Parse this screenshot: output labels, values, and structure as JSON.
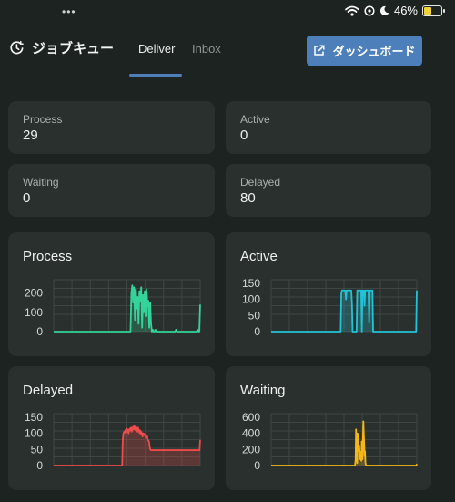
{
  "statusbar": {
    "more": "•••",
    "battery_text": "46%",
    "battery_level": 0.46,
    "icons": [
      "wifi-icon",
      "focus-icon",
      "moon-icon",
      "battery-icon"
    ]
  },
  "header": {
    "title": "ジョブキュー",
    "tabs": [
      {
        "label": "Deliver",
        "active": true
      },
      {
        "label": "Inbox",
        "active": false
      }
    ],
    "dashboard_button": "ダッシュボード"
  },
  "stats": [
    {
      "label": "Process",
      "value": "29"
    },
    {
      "label": "Active",
      "value": "0"
    },
    {
      "label": "Waiting",
      "value": "0"
    },
    {
      "label": "Delayed",
      "value": "80"
    }
  ],
  "colors": {
    "accent": "#4d7fba",
    "process": "#34d399",
    "active": "#22c3d6",
    "delayed": "#ef4b4b",
    "waiting": "#f5b816"
  },
  "chart_data": [
    {
      "type": "area",
      "title": "Process",
      "color": "#34d399",
      "ylim": [
        0,
        250
      ],
      "yticks": [
        0,
        100,
        200
      ],
      "grid": true,
      "values": [
        0,
        0,
        0,
        0,
        0,
        0,
        0,
        0,
        0,
        0,
        0,
        0,
        0,
        0,
        0,
        0,
        0,
        0,
        0,
        0,
        0,
        0,
        0,
        0,
        0,
        0,
        0,
        0,
        0,
        0,
        0,
        0,
        0,
        0,
        0,
        0,
        0,
        0,
        0,
        0,
        0,
        0,
        0,
        0,
        0,
        0,
        0,
        0,
        0,
        0,
        0,
        0,
        0,
        0,
        0,
        0,
        0,
        0,
        0,
        0,
        0,
        0,
        0,
        0,
        0,
        0,
        0,
        0,
        0,
        0,
        0,
        0,
        0,
        0,
        0,
        0,
        0,
        0,
        0,
        0,
        0,
        0,
        0,
        0,
        0,
        0,
        0,
        200,
        240,
        150,
        230,
        60,
        220,
        120,
        180,
        40,
        210,
        160,
        230,
        20,
        190,
        100,
        210,
        80,
        220,
        130,
        160,
        20,
        150,
        40,
        0,
        10,
        0,
        0,
        10,
        0,
        0,
        0,
        0,
        0,
        0,
        0,
        0,
        0,
        0,
        0,
        0,
        0,
        0,
        0,
        0,
        0,
        0,
        0,
        0,
        0,
        0,
        10,
        0,
        0,
        0,
        0,
        0,
        0,
        0,
        0,
        0,
        0,
        0,
        0,
        0,
        0,
        0,
        0,
        0,
        0,
        0,
        0,
        0,
        0,
        0,
        10,
        0,
        0,
        140
      ]
    },
    {
      "type": "area",
      "title": "Active",
      "color": "#22c3d6",
      "ylim": [
        0,
        150
      ],
      "yticks": [
        0,
        50,
        100,
        150
      ],
      "grid": true,
      "values": [
        0,
        0,
        0,
        0,
        0,
        0,
        0,
        0,
        0,
        0,
        0,
        0,
        0,
        0,
        0,
        0,
        0,
        0,
        0,
        0,
        0,
        0,
        0,
        0,
        0,
        0,
        0,
        0,
        0,
        0,
        0,
        0,
        0,
        0,
        0,
        0,
        0,
        0,
        0,
        0,
        0,
        0,
        0,
        0,
        0,
        0,
        0,
        0,
        0,
        0,
        0,
        0,
        0,
        0,
        0,
        0,
        0,
        0,
        0,
        0,
        0,
        0,
        0,
        0,
        0,
        0,
        0,
        0,
        0,
        0,
        0,
        0,
        0,
        0,
        0,
        0,
        0,
        0,
        0,
        0,
        0,
        0,
        0,
        0,
        0,
        0,
        0,
        0,
        0,
        0,
        0,
        0,
        0,
        0,
        0,
        0,
        0,
        0,
        0,
        0,
        0,
        0,
        0,
        0,
        0,
        0,
        120,
        128,
        128,
        128,
        128,
        128,
        128,
        100,
        128,
        128,
        128,
        128,
        128,
        128,
        128,
        128,
        90,
        0,
        0,
        0,
        0,
        0,
        0,
        0,
        128,
        128,
        128,
        128,
        128,
        128,
        128,
        0,
        128,
        128,
        128,
        80,
        128,
        128,
        128,
        128,
        128,
        128,
        30,
        128,
        128,
        128,
        128,
        128,
        0,
        0,
        0,
        0,
        0,
        0,
        0,
        0,
        0,
        0,
        0,
        0,
        0,
        0,
        0,
        0,
        0,
        0,
        0,
        0,
        0,
        0,
        0,
        0,
        0,
        0,
        0,
        0,
        0,
        0,
        0,
        0,
        0,
        0,
        0,
        0,
        0,
        0,
        0,
        0,
        0,
        0,
        0,
        0,
        0,
        0,
        0,
        0,
        0,
        0,
        0,
        0,
        0,
        0,
        0,
        0,
        0,
        0,
        0,
        0,
        0,
        0,
        0,
        0,
        0,
        0,
        128
      ]
    },
    {
      "type": "area",
      "title": "Delayed",
      "color": "#ef4b4b",
      "ylim": [
        0,
        150
      ],
      "yticks": [
        0,
        50,
        100,
        150
      ],
      "grid": true,
      "values": [
        0,
        0,
        0,
        0,
        0,
        0,
        0,
        0,
        0,
        0,
        0,
        0,
        0,
        0,
        0,
        0,
        0,
        0,
        0,
        0,
        0,
        0,
        0,
        0,
        0,
        0,
        0,
        0,
        0,
        0,
        0,
        0,
        0,
        0,
        0,
        0,
        0,
        0,
        0,
        0,
        0,
        0,
        0,
        0,
        0,
        0,
        0,
        0,
        0,
        0,
        0,
        0,
        0,
        0,
        0,
        0,
        0,
        0,
        0,
        0,
        0,
        0,
        0,
        0,
        0,
        0,
        0,
        0,
        0,
        0,
        0,
        0,
        0,
        0,
        0,
        0,
        0,
        0,
        0,
        0,
        0,
        0,
        0,
        0,
        0,
        0,
        0,
        0,
        0,
        0,
        0,
        0,
        0,
        0,
        0,
        0,
        0,
        0,
        0,
        0,
        0,
        0,
        0,
        0,
        0,
        0,
        0,
        0,
        80,
        100,
        105,
        102,
        110,
        103,
        115,
        105,
        112,
        100,
        108,
        115,
        110,
        118,
        105,
        112,
        120,
        112,
        125,
        115,
        110,
        120,
        112,
        105,
        118,
        108,
        102,
        110,
        98,
        105,
        100,
        90,
        100,
        96,
        98,
        92,
        88,
        85,
        92,
        80,
        78,
        75,
        60,
        50,
        48,
        48,
        48,
        48,
        48,
        48,
        48,
        48,
        48,
        48,
        48,
        48,
        48,
        48,
        48,
        48,
        48,
        48,
        48,
        48,
        48,
        48,
        48,
        48,
        48,
        48,
        48,
        48,
        48,
        48,
        48,
        48,
        48,
        48,
        48,
        48,
        48,
        48,
        48,
        48,
        48,
        48,
        48,
        48,
        48,
        48,
        48,
        48,
        48,
        48,
        48,
        48,
        48,
        48,
        48,
        48,
        48,
        48,
        48,
        48,
        48,
        48,
        48,
        48,
        48,
        48,
        48,
        48,
        48,
        48,
        48,
        48,
        48,
        48,
        48,
        48,
        48,
        80
      ]
    },
    {
      "type": "area",
      "title": "Waiting",
      "color": "#f5b816",
      "ylim": [
        0,
        600
      ],
      "yticks": [
        0,
        200,
        400,
        600
      ],
      "grid": true,
      "values": [
        0,
        0,
        0,
        0,
        0,
        0,
        0,
        0,
        0,
        0,
        0,
        0,
        0,
        0,
        0,
        0,
        0,
        0,
        0,
        0,
        0,
        0,
        0,
        0,
        0,
        0,
        0,
        0,
        0,
        0,
        0,
        0,
        0,
        0,
        0,
        0,
        0,
        0,
        0,
        0,
        0,
        0,
        0,
        0,
        0,
        0,
        0,
        0,
        0,
        0,
        0,
        0,
        0,
        0,
        0,
        0,
        0,
        0,
        0,
        0,
        0,
        0,
        0,
        0,
        0,
        0,
        0,
        0,
        0,
        0,
        0,
        0,
        0,
        0,
        0,
        0,
        0,
        0,
        0,
        0,
        0,
        0,
        0,
        0,
        0,
        0,
        0,
        0,
        0,
        0,
        0,
        0,
        0,
        0,
        0,
        0,
        0,
        0,
        0,
        0,
        0,
        0,
        0,
        0,
        0,
        0,
        0,
        0,
        0,
        0,
        0,
        0,
        0,
        0,
        0,
        0,
        0,
        0,
        0,
        0,
        0,
        0,
        0,
        0,
        0,
        0,
        0,
        0,
        0,
        0,
        0,
        0,
        0,
        0,
        0,
        0,
        0,
        0,
        0,
        0,
        0,
        0,
        0,
        0,
        0,
        0,
        0,
        0,
        0,
        0,
        0,
        0,
        0,
        0,
        0,
        0,
        0,
        0,
        0,
        0,
        0,
        0,
        0,
        0,
        0,
        0,
        0,
        0,
        0,
        0,
        0,
        0,
        0,
        0,
        0,
        0,
        0,
        0,
        0,
        0,
        0,
        0,
        0,
        0,
        0,
        0,
        0,
        0,
        0,
        0,
        0,
        0,
        0,
        0,
        0,
        0,
        0,
        0,
        0,
        0,
        0,
        0,
        0,
        0,
        0,
        0,
        20,
        80,
        450,
        250,
        100,
        30,
        400,
        320,
        200,
        180,
        250,
        150,
        80,
        170,
        100,
        60,
        300,
        120,
        80,
        350,
        550,
        400,
        280,
        120,
        180,
        40,
        10,
        0,
        0,
        0,
        0,
        0,
        0,
        0,
        0,
        0,
        0,
        0,
        0,
        0,
        0,
        0,
        0,
        0,
        0,
        0,
        0,
        0,
        0,
        0,
        0,
        0,
        0,
        0,
        0,
        0,
        0,
        0,
        0,
        0,
        0,
        0,
        0,
        0,
        0,
        0,
        0,
        0,
        0,
        0,
        0,
        0,
        0,
        0,
        0,
        0,
        0,
        0,
        0,
        0,
        0,
        0,
        0,
        0,
        0,
        0,
        0,
        0,
        0,
        0,
        0,
        0,
        0,
        0,
        0,
        0,
        0,
        0,
        0,
        0,
        0,
        0,
        0,
        0,
        0,
        0,
        0,
        0,
        0,
        0,
        0,
        0,
        0,
        0,
        0,
        0,
        0,
        0,
        0,
        0,
        0,
        0,
        0,
        0,
        0,
        0,
        0,
        0,
        0,
        0,
        0,
        0,
        0,
        0,
        0,
        0,
        0,
        0,
        0,
        0,
        0,
        0,
        0,
        0,
        0,
        0,
        0,
        0,
        0,
        0,
        0,
        20
      ]
    }
  ]
}
